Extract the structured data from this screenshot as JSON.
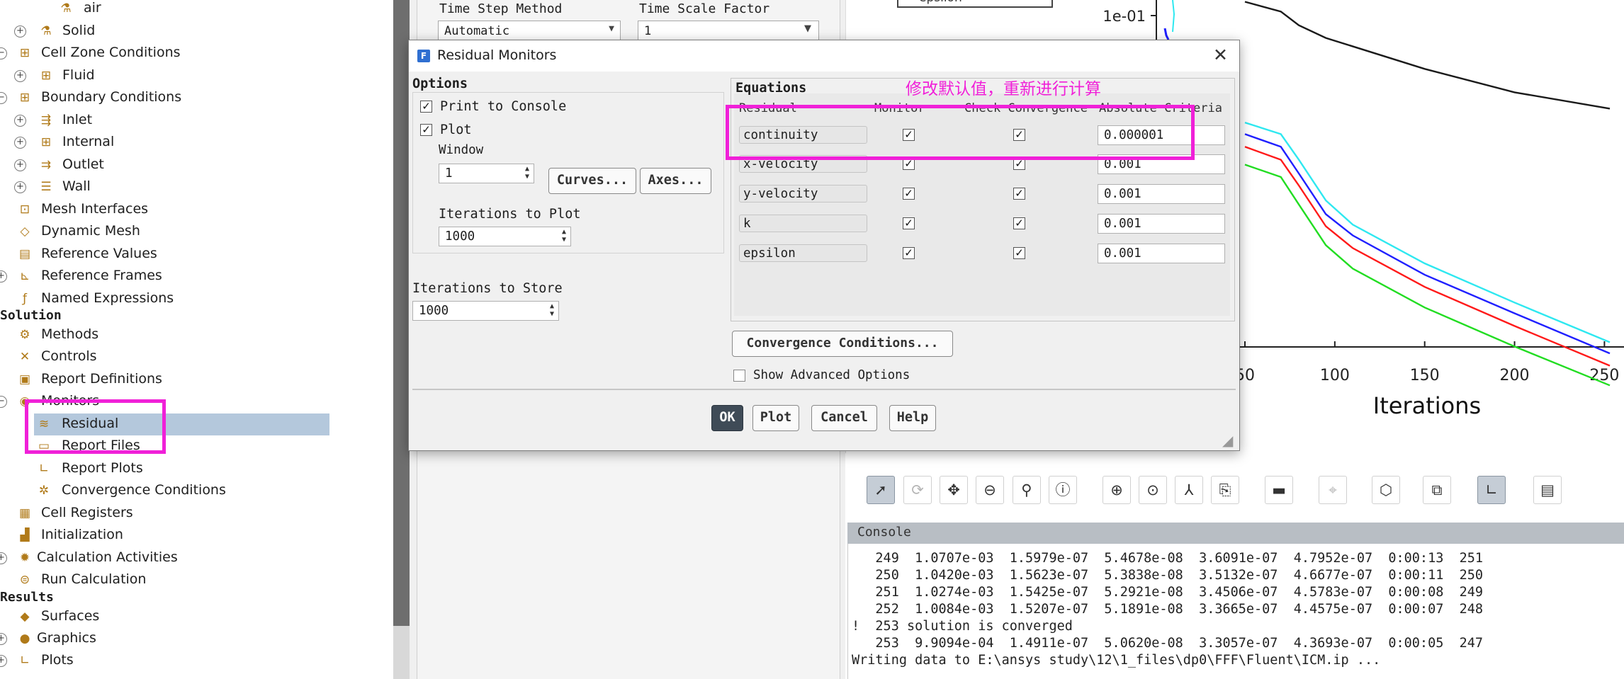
{
  "tree": {
    "items": [
      {
        "label": "air",
        "toggle": "",
        "icon": "flask-icon",
        "glyph": "⚗"
      },
      {
        "label": "Solid",
        "toggle": "+",
        "icon": "flask-icon",
        "glyph": "⚗"
      },
      {
        "label": "Cell Zone Conditions",
        "toggle": "−",
        "icon": "grid-icon",
        "glyph": "⊞"
      },
      {
        "label": "Fluid",
        "toggle": "+",
        "icon": "grid-icon",
        "glyph": "⊞"
      },
      {
        "label": "Boundary Conditions",
        "toggle": "−",
        "icon": "grid-icon",
        "glyph": "⊞"
      },
      {
        "label": "Inlet",
        "toggle": "+",
        "icon": "inlet-icon",
        "glyph": "⇶"
      },
      {
        "label": "Internal",
        "toggle": "+",
        "icon": "grid-icon",
        "glyph": "⊞"
      },
      {
        "label": "Outlet",
        "toggle": "+",
        "icon": "outlet-icon",
        "glyph": "⇉"
      },
      {
        "label": "Wall",
        "toggle": "+",
        "icon": "wall-icon",
        "glyph": "☰"
      },
      {
        "label": "Mesh Interfaces",
        "toggle": "",
        "icon": "mesh-interface-icon",
        "glyph": "⊡"
      },
      {
        "label": "Dynamic Mesh",
        "toggle": "",
        "icon": "dynamic-mesh-icon",
        "glyph": "◇"
      },
      {
        "label": "Reference Values",
        "toggle": "",
        "icon": "reference-values-icon",
        "glyph": "▤"
      },
      {
        "label": "Reference Frames",
        "toggle": "+",
        "icon": "axes-icon",
        "glyph": "⊾"
      },
      {
        "label": "Named Expressions",
        "toggle": "",
        "icon": "function-icon",
        "glyph": "ƒ"
      },
      {
        "label": "Solution",
        "toggle": "",
        "icon": "",
        "glyph": "",
        "section": true
      },
      {
        "label": "Methods",
        "toggle": "",
        "icon": "methods-icon",
        "glyph": "⚙"
      },
      {
        "label": "Controls",
        "toggle": "",
        "icon": "controls-icon",
        "glyph": "✕"
      },
      {
        "label": "Report Definitions",
        "toggle": "",
        "icon": "report-definitions-icon",
        "glyph": "▣"
      },
      {
        "label": "Monitors",
        "toggle": "−",
        "icon": "monitors-icon",
        "glyph": "◉"
      },
      {
        "label": "Residual",
        "toggle": "",
        "icon": "residual-icon",
        "glyph": "≋"
      },
      {
        "label": "Report Files",
        "toggle": "",
        "icon": "report-file-icon",
        "glyph": "▭"
      },
      {
        "label": "Report Plots",
        "toggle": "",
        "icon": "report-plot-icon",
        "glyph": "∟"
      },
      {
        "label": "Convergence Conditions",
        "toggle": "",
        "icon": "convergence-icon",
        "glyph": "✲"
      },
      {
        "label": "Cell Registers",
        "toggle": "",
        "icon": "cell-registers-icon",
        "glyph": "▦"
      },
      {
        "label": "Initialization",
        "toggle": "",
        "icon": "initialization-icon",
        "glyph": "▟"
      },
      {
        "label": "Calculation Activities",
        "toggle": "+",
        "icon": "activities-icon",
        "glyph": "✹"
      },
      {
        "label": "Run Calculation",
        "toggle": "",
        "icon": "run-calculation-icon",
        "glyph": "⊜"
      },
      {
        "label": "Results",
        "toggle": "",
        "icon": "",
        "glyph": "",
        "section": true
      },
      {
        "label": "Surfaces",
        "toggle": "",
        "icon": "surfaces-icon",
        "glyph": "◆"
      },
      {
        "label": "Graphics",
        "toggle": "+",
        "icon": "graphics-icon",
        "glyph": "●"
      },
      {
        "label": "Plots",
        "toggle": "+",
        "icon": "plots-icon",
        "glyph": "∟"
      }
    ]
  },
  "task_panel": {
    "time_step_method_label": "Time Step Method",
    "time_step_method_value": "Automatic",
    "time_scale_factor_label": "Time Scale Factor",
    "time_scale_factor_value": "1"
  },
  "dialog": {
    "title": "Residual Monitors",
    "options_label": "Options",
    "print_to_console": "Print to Console",
    "plot": "Plot",
    "window_label": "Window",
    "window_value": "1",
    "curves_button": "Curves...",
    "axes_button": "Axes...",
    "iterations_to_plot_label": "Iterations to Plot",
    "iterations_to_plot_value": "1000",
    "iterations_to_store_label": "Iterations to Store",
    "iterations_to_store_value": "1000",
    "equations_label": "Equations",
    "col_residual": "Residual",
    "col_monitor": "Monitor",
    "col_check": "Check Convergence",
    "col_criteria": "Absolute Criteria",
    "rows": [
      {
        "name": "continuity",
        "criteria": "0.000001"
      },
      {
        "name": "x-velocity",
        "criteria": "0.001"
      },
      {
        "name": "y-velocity",
        "criteria": "0.001"
      },
      {
        "name": "k",
        "criteria": "0.001"
      },
      {
        "name": "epsilon",
        "criteria": "0.001"
      }
    ],
    "convergence_button": "Convergence Conditions...",
    "show_advanced": "Show Advanced Options",
    "ok": "OK",
    "plot_button": "Plot",
    "cancel": "Cancel",
    "help": "Help"
  },
  "annotation": {
    "text": "修改默认值，重新进行计算",
    "color": "#f020d8"
  },
  "chart_data": {
    "type": "line",
    "xlabel": "Iterations",
    "ylabel": "",
    "legend_fragment": "epsilon",
    "x_ticks": [
      "50",
      "100",
      "150",
      "200",
      "250"
    ],
    "y_ticks": [
      "1e-01"
    ],
    "xlim": [
      50,
      253
    ],
    "series": [
      {
        "color": "#1a1a1a",
        "x": [
          50,
          70,
          80,
          95,
          150,
          200,
          253
        ],
        "y": [
          0.16,
          0.12,
          0.08,
          0.055,
          0.022,
          0.011,
          0.0068
        ]
      },
      {
        "color": "#2ee8f0",
        "x": [
          50,
          70,
          80,
          95,
          110,
          150,
          200,
          253
        ],
        "y": [
          0.0045,
          0.0032,
          0.0015,
          0.00045,
          0.00022,
          7e-05,
          2.2e-05,
          6.8e-06
        ]
      },
      {
        "color": "#2020ff",
        "x": [
          50,
          70,
          80,
          95,
          110,
          150,
          200,
          253
        ],
        "y": [
          0.0032,
          0.0022,
          0.001,
          0.0003,
          0.00016,
          5e-05,
          1.6e-05,
          4.9e-06
        ]
      },
      {
        "color": "#ff1a1a",
        "x": [
          50,
          70,
          80,
          95,
          110,
          150,
          200,
          253
        ],
        "y": [
          0.0022,
          0.0015,
          0.0007,
          0.00021,
          0.00011,
          3.5e-05,
          1.1e-05,
          3.4e-06
        ]
      },
      {
        "color": "#22dd22",
        "x": [
          50,
          70,
          80,
          95,
          110,
          150,
          200,
          253
        ],
        "y": [
          0.0013,
          0.0009,
          0.0004,
          0.00012,
          6e-05,
          1.9e-05,
          6e-06,
          1.9e-06
        ]
      }
    ]
  },
  "console": {
    "header": "Console",
    "lines": [
      "   249  1.0707e-03  1.5979e-07  5.4678e-08  3.6091e-07  4.7952e-07  0:00:13  251",
      "   250  1.0420e-03  1.5623e-07  5.3838e-08  3.5132e-07  4.6677e-07  0:00:11  250",
      "   251  1.0274e-03  1.5425e-07  5.2921e-08  3.4506e-07  4.5783e-07  0:00:08  249",
      "   252  1.0084e-03  1.5207e-07  5.1891e-08  3.3665e-07  4.4575e-07  0:00:07  248",
      "!  253 solution is converged",
      "   253  9.9094e-04  1.4911e-07  5.0620e-08  3.3057e-07  4.3693e-07  0:00:05  247",
      "Writing data to E:\\ansys study\\12\\1_files\\dp0\\FFF\\Fluent\\ICM.ip ..."
    ]
  }
}
